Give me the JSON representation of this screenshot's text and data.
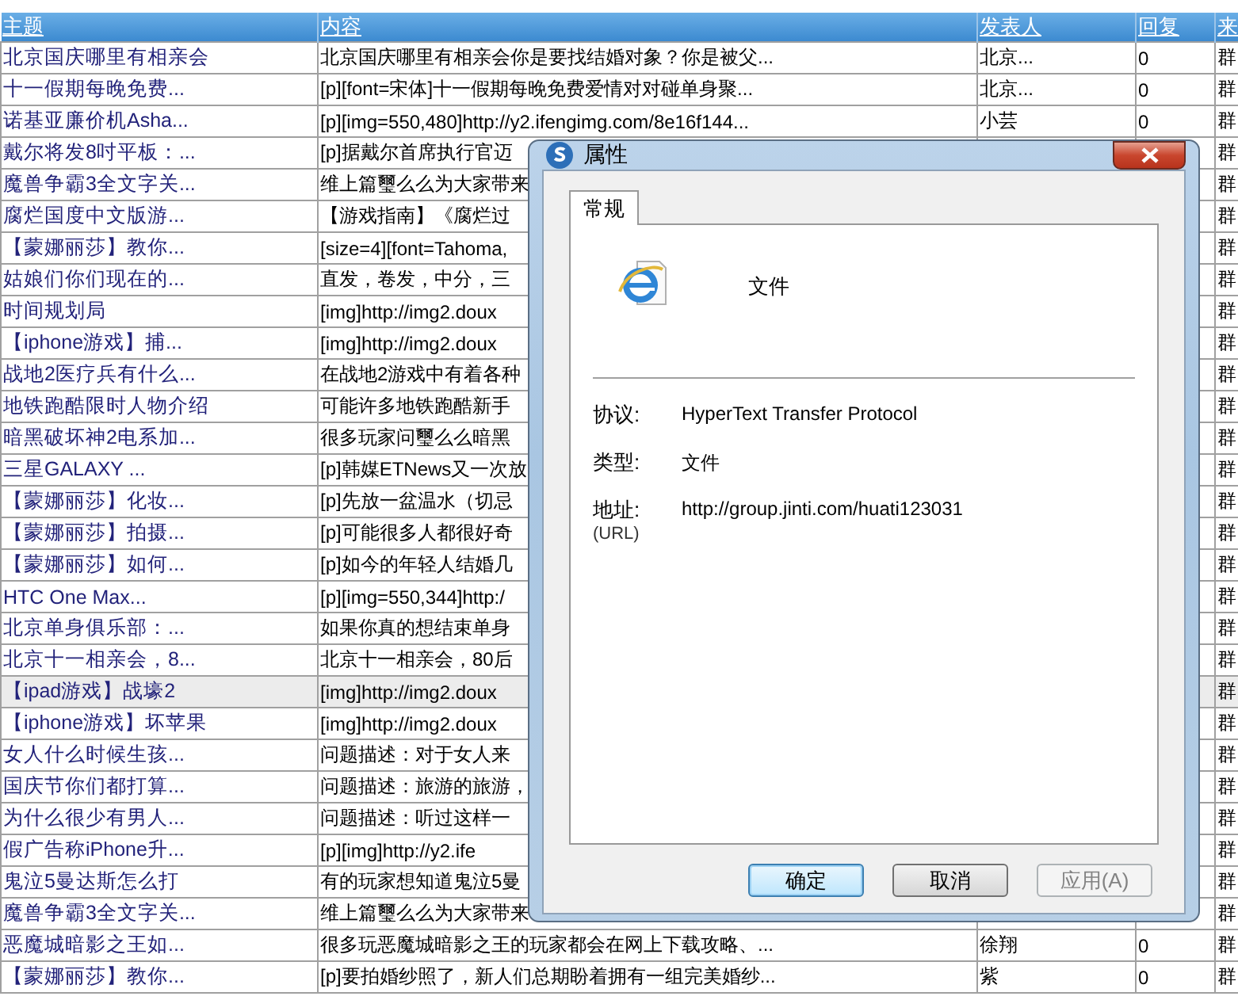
{
  "table": {
    "columns": [
      "主题",
      "内容",
      "发表人",
      "回复",
      "来"
    ],
    "rows": [
      {
        "title": "北京国庆哪里有相亲会",
        "content": "北京国庆哪里有相亲会你是要找结婚对象？你是被父...",
        "author": "北京...",
        "replies": "0",
        "source": "群",
        "selected": false
      },
      {
        "title": "十一假期每晚免费...",
        "content": "[p][font=宋体]十一假期每晚免费爱情对对碰单身聚...",
        "author": "北京...",
        "replies": "0",
        "source": "群",
        "selected": false
      },
      {
        "title": "诺基亚廉价机Asha...",
        "content": "[p][img=550,480]http://y2.ifengimg.com/8e16f144...",
        "author": "小芸",
        "replies": "0",
        "source": "群",
        "selected": false
      },
      {
        "title": "戴尔将发8吋平板：...",
        "content": "[p]据戴尔首席执行官迈",
        "source": "群",
        "selected": false
      },
      {
        "title": "魔兽争霸3全文字关...",
        "content": "维上篇璽么么为大家带来",
        "source": "群",
        "selected": false
      },
      {
        "title": "腐烂国度中文版游...",
        "content": "【游戏指南】《腐烂过",
        "source": "群",
        "selected": false
      },
      {
        "title": "【蒙娜丽莎】教你...",
        "content": "[size=4][font=Tahoma,",
        "source": "群",
        "selected": false
      },
      {
        "title": "姑娘们你们现在的...",
        "content": "直发，卷发，中分，三",
        "source": "群",
        "selected": false
      },
      {
        "title": "时间规划局",
        "content": "[img]http://img2.doux",
        "source": "群",
        "selected": false
      },
      {
        "title": "【iphone游戏】捕...",
        "content": "[img]http://img2.doux",
        "source": "群",
        "selected": false
      },
      {
        "title": "战地2医疗兵有什么...",
        "content": "在战地2游戏中有着各种",
        "source": "群",
        "selected": false
      },
      {
        "title": "地铁跑酷限时人物介绍",
        "content": "可能许多地铁跑酷新手",
        "source": "群",
        "selected": false
      },
      {
        "title": "暗黑破坏神2电系加...",
        "content": "很多玩家问璽么么暗黑",
        "source": "群",
        "selected": false
      },
      {
        "title": "三星GALAXY ...",
        "content": "[p]韩媒ETNews又一次放",
        "source": "群",
        "selected": false
      },
      {
        "title": "【蒙娜丽莎】化妆...",
        "content": "[p]先放一盆温水（切忌",
        "source": "群",
        "selected": false
      },
      {
        "title": "【蒙娜丽莎】拍摄...",
        "content": "[p]可能很多人都很好奇",
        "source": "群",
        "selected": false
      },
      {
        "title": "【蒙娜丽莎】如何...",
        "content": "[p]如今的年轻人结婚几",
        "source": "群",
        "selected": false
      },
      {
        "title": "HTC One Max...",
        "content": "[p][img=550,344]http:/",
        "source": "群",
        "selected": false
      },
      {
        "title": "北京单身俱乐部：...",
        "content": "如果你真的想结束单身",
        "source": "群",
        "selected": false
      },
      {
        "title": "北京十一相亲会，8...",
        "content": "北京十一相亲会，80后",
        "source": "群",
        "selected": false
      },
      {
        "title": "【ipad游戏】战壕2",
        "content": "[img]http://img2.doux",
        "source": "群",
        "selected": true
      },
      {
        "title": "【iphone游戏】坏苹果",
        "content": "[img]http://img2.doux",
        "source": "群",
        "selected": false
      },
      {
        "title": "女人什么时候生孩...",
        "content": "问题描述：对于女人来",
        "source": "群",
        "selected": false
      },
      {
        "title": "国庆节你们都打算...",
        "content": "问题描述：旅游的旅游，",
        "source": "群",
        "selected": false
      },
      {
        "title": "为什么很少有男人...",
        "content": "问题描述：听过这样一",
        "source": "群",
        "selected": false
      },
      {
        "title": "假广告称iPhone升...",
        "content": "[p][img]http://y2.ife",
        "source": "群",
        "selected": false
      },
      {
        "title": "鬼泣5曼达斯怎么打",
        "content": "有的玩家想知道鬼泣5曼",
        "source": "群",
        "selected": false
      },
      {
        "title": "魔兽争霸3全文字关...",
        "content": "维上篇璽么么为大家带来",
        "source": "群",
        "selected": false
      },
      {
        "title": "恶魔城暗影之王如...",
        "content": "很多玩恶魔城暗影之王的玩家都会在网上下载攻略、...",
        "author": "徐翔",
        "replies": "0",
        "source": "群",
        "selected": false
      },
      {
        "title": "【蒙娜丽莎】教你...",
        "content": "[p]要拍婚纱照了，新人们总期盼着拥有一组完美婚纱...",
        "author": "紫",
        "replies": "0",
        "source": "群",
        "selected": false
      }
    ]
  },
  "dialog": {
    "title": "属性",
    "tabs": [
      {
        "label": "常规",
        "selected": true
      }
    ],
    "file_name": "文件",
    "properties": [
      {
        "label": "协议:",
        "value": "HyperText Transfer Protocol"
      },
      {
        "label": "类型:",
        "value": "文件"
      },
      {
        "label": "地址:",
        "sublabel": "(URL)",
        "value": "http://group.jinti.com/huati123031"
      }
    ],
    "buttons": [
      {
        "label": "确定",
        "kind": "default",
        "disabled": false
      },
      {
        "label": "取消",
        "kind": "normal",
        "disabled": false
      },
      {
        "label": "应用(A)",
        "kind": "normal",
        "disabled": true
      }
    ]
  }
}
